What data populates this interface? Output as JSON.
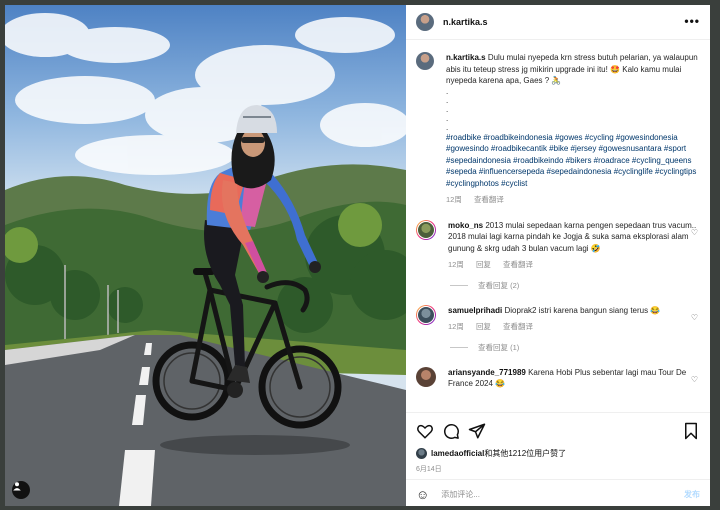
{
  "header": {
    "username": "n.kartika.s",
    "more_icon": "more-horizontal-icon"
  },
  "caption": {
    "username": "n.kartika.s",
    "text": "Dulu mulai nyepeda krn stress butuh pelarian, ya walaupun abis itu teteup stress jg mikirin upgrade ini itu! 🤩 Kalo kamu mulai nyepeda karena apa, Gaes ? 🚴",
    "dots": [
      ".",
      ".",
      ".",
      ".",
      "."
    ],
    "hashtags": "#roadbike #roadbikeindonesia #gowes #cycling #gowesindonesia #gowesindo #roadbikecantik #bike #jersey #gowesnusantara #sport #sepedaindonesia #roadbikeindo #bikers #roadrace #cycling_queens #sepeda #influencersepeda #sepedaindonesia #cyclinglife #cyclingtips #cyclingphotos #cyclist",
    "age": "12周",
    "translate": "查看翻译"
  },
  "comments": [
    {
      "username": "moko_ns",
      "text": "2013 mulai sepedaan karna pengen sepedaan trus vacum.. 2018 mulai lagi karna pindah ke Jogja & suka sama eksplorasi alam gunung & skrg udah 3 bulan vacum lagi 🤣",
      "age": "12周",
      "reply": "回复",
      "translate": "查看翻译",
      "view_replies": "查看回复 (2)"
    },
    {
      "username": "samuelprihadi",
      "text": "Dioprak2 istri karena bangun siang terus 😂",
      "age": "12周",
      "reply": "回复",
      "translate": "查看翻译",
      "view_replies": "查看回复 (1)"
    },
    {
      "username": "ariansyande_771989",
      "text": "Karena Hobi Plus sebentar lagi mau Tour De France 2024 😂"
    }
  ],
  "likes": {
    "user": "lamedaofficial",
    "text": "和其他1212位用户赞了"
  },
  "date": "6月14日",
  "add_comment": {
    "placeholder": "添加评论...",
    "post_label": "发布"
  },
  "icons": [
    "heart-icon",
    "comment-icon",
    "share-icon",
    "bookmark-icon",
    "emoji-icon",
    "user-tag-icon"
  ]
}
